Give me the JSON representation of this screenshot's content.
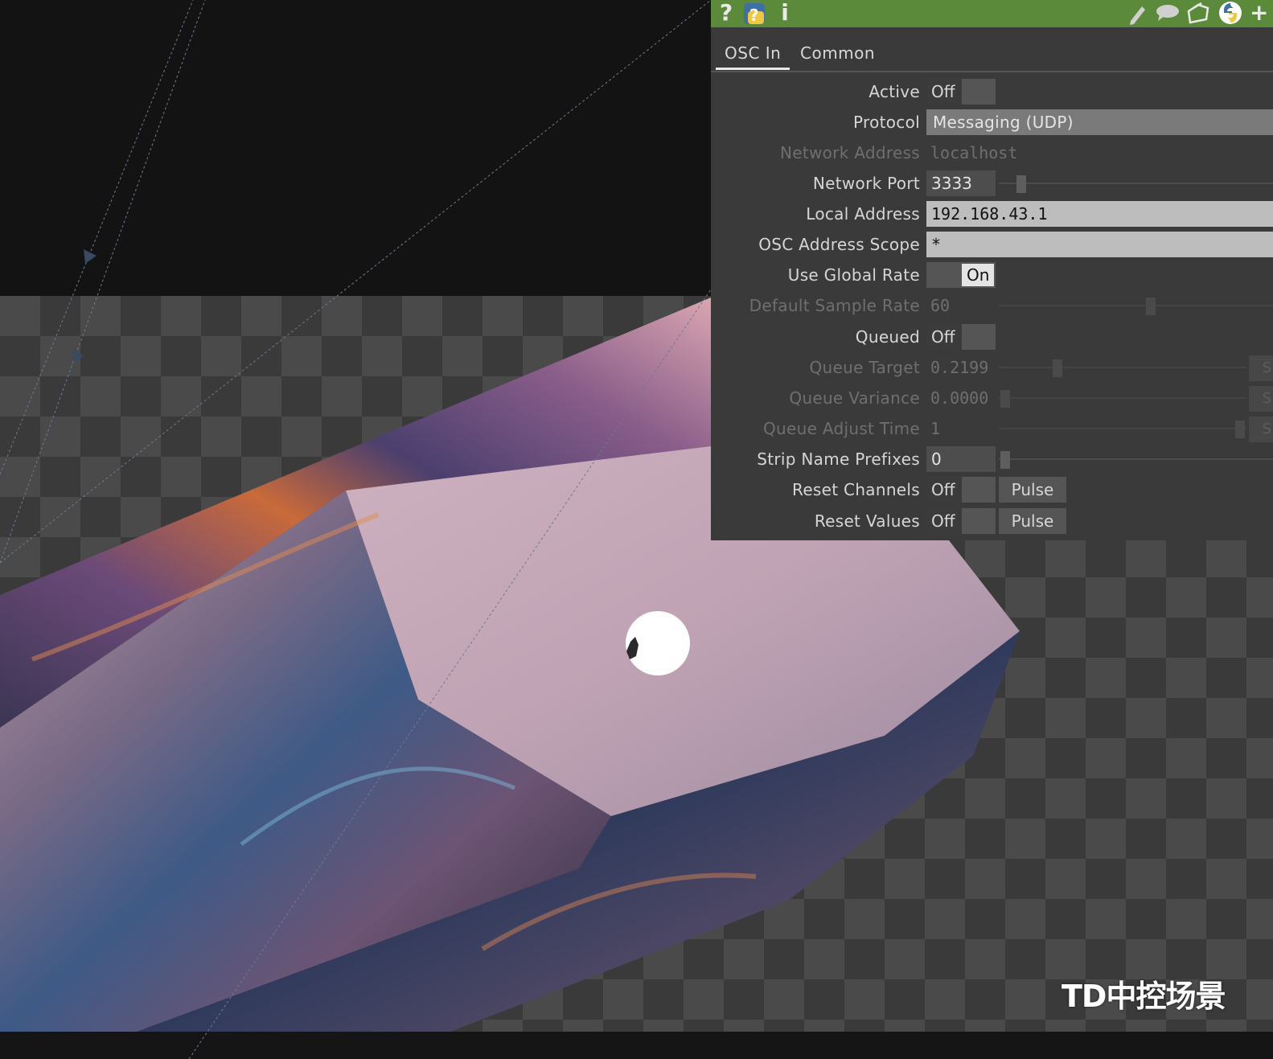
{
  "toolbar": {
    "color": "#5b8a3a",
    "left_icons": [
      "help-icon",
      "python-help-icon",
      "info-icon"
    ],
    "right_icons": [
      "pencil-icon",
      "comment-icon",
      "clone-icon",
      "python-icon",
      "add-icon"
    ]
  },
  "tabs": [
    {
      "label": "OSC In",
      "active": true
    },
    {
      "label": "Common",
      "active": false
    }
  ],
  "params": {
    "active": {
      "label": "Active",
      "value": "Off"
    },
    "protocol": {
      "label": "Protocol",
      "value": "Messaging (UDP)"
    },
    "network_address": {
      "label": "Network Address",
      "value": "localhost"
    },
    "network_port": {
      "label": "Network Port",
      "value": "3333"
    },
    "local_address": {
      "label": "Local Address",
      "value": "192.168.43.1"
    },
    "osc_address_scope": {
      "label": "OSC Address Scope",
      "value": "*"
    },
    "use_global_rate": {
      "label": "Use Global Rate",
      "value": "On"
    },
    "default_sample_rate": {
      "label": "Default Sample Rate",
      "value": "60"
    },
    "queued": {
      "label": "Queued",
      "value": "Off"
    },
    "queue_target": {
      "label": "Queue Target",
      "value": "0.2199"
    },
    "queue_variance": {
      "label": "Queue Variance",
      "value": "0.0000"
    },
    "queue_adjust_time": {
      "label": "Queue Adjust Time",
      "value": "1"
    },
    "strip_name_prefixes": {
      "label": "Strip Name Prefixes",
      "value": "0"
    },
    "reset_channels": {
      "label": "Reset Channels",
      "value": "Off",
      "pulse": "Pulse"
    },
    "reset_values": {
      "label": "Reset Values",
      "value": "Off",
      "pulse": "Pulse"
    }
  },
  "watermark": "TD中控场景"
}
